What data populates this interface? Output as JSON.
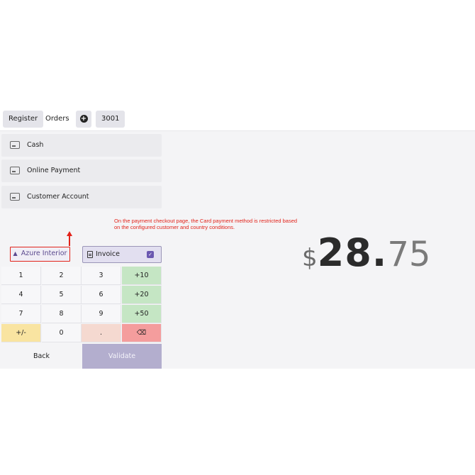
{
  "topbar": {
    "register": "Register",
    "orders": "Orders",
    "plus": "+",
    "order_number": "3001"
  },
  "payment_methods": [
    {
      "label": "Cash",
      "icon": "cash-icon"
    },
    {
      "label": "Online Payment",
      "icon": "card-icon"
    },
    {
      "label": "Customer Account",
      "icon": "account-icon"
    }
  ],
  "annotation": {
    "text": "On the payment checkout page, the Card payment method is restricted based on the configured customer and country conditions.",
    "color": "#e2231a"
  },
  "customer": {
    "label": "Azure Interior",
    "icon": "user-icon"
  },
  "invoice": {
    "label": "Invoice",
    "checked": true,
    "check_glyph": "✓"
  },
  "numpad": {
    "keys": [
      [
        "1",
        "2",
        "3",
        "+10"
      ],
      [
        "4",
        "5",
        "6",
        "+20"
      ],
      [
        "7",
        "8",
        "9",
        "+50"
      ],
      [
        "+/-",
        "0",
        ".",
        "⌫"
      ]
    ]
  },
  "actions": {
    "back": "Back",
    "validate": "Validate"
  },
  "total": {
    "currency": "$",
    "integer": "28.",
    "decimal": "75"
  },
  "colors": {
    "accent": "#6b58b0",
    "quick_add": "#c5e6c4",
    "sign": "#f9e4a1",
    "backspace": "#f49d9d",
    "validate": "#b3aece"
  }
}
